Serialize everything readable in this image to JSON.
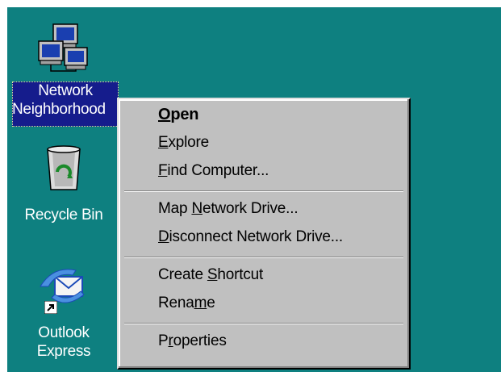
{
  "desktop": {
    "background": "#0e8080",
    "icons": [
      {
        "name": "network-neighborhood",
        "label_line1": "Network",
        "label_line2": "Neighborhood",
        "icon": "network-computers-icon",
        "selected": true
      },
      {
        "name": "recycle-bin",
        "label_line1": "Recycle Bin",
        "icon": "recycle-bin-icon",
        "selected": false
      },
      {
        "name": "outlook-express",
        "label_line1": "Outlook",
        "label_line2": "Express",
        "icon": "outlook-express-icon",
        "selected": false,
        "shortcut": true
      }
    ]
  },
  "context_menu": {
    "background": "#c0c0c0",
    "groups": [
      [
        {
          "pre": "",
          "key": "O",
          "post": "pen",
          "default": true
        },
        {
          "pre": "",
          "key": "E",
          "post": "xplore"
        },
        {
          "pre": "",
          "key": "F",
          "post": "ind Computer..."
        }
      ],
      [
        {
          "pre": "Map ",
          "key": "N",
          "post": "etwork Drive..."
        },
        {
          "pre": "",
          "key": "D",
          "post": "isconnect Network Drive..."
        }
      ],
      [
        {
          "pre": "Create ",
          "key": "S",
          "post": "hortcut"
        },
        {
          "pre": "Rena",
          "key": "m",
          "post": "e"
        }
      ],
      [
        {
          "pre": "P",
          "key": "r",
          "post": "operties"
        }
      ]
    ]
  }
}
